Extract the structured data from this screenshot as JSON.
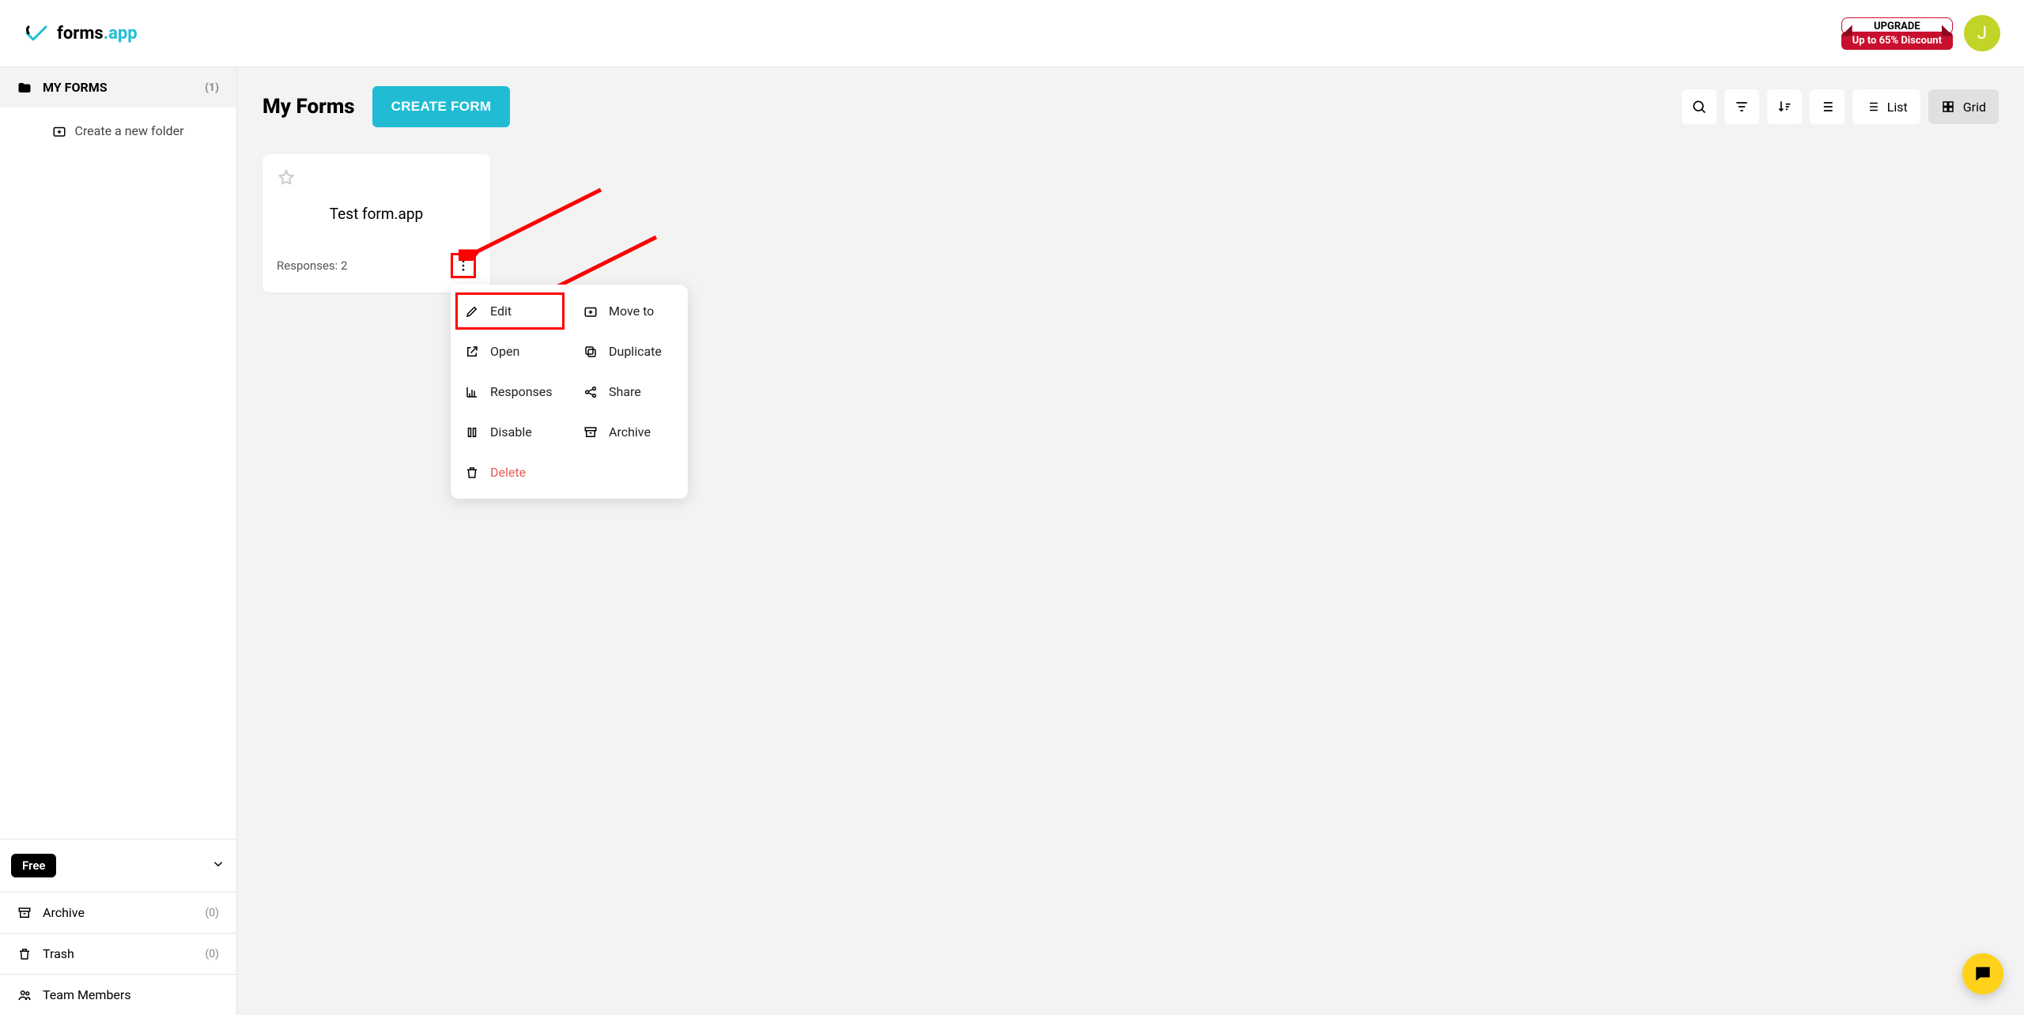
{
  "brand": {
    "name1": "forms",
    "name2": ".app"
  },
  "upgrade": {
    "label": "UPGRADE",
    "banner": "Up to 65% Discount"
  },
  "avatar": {
    "initial": "J"
  },
  "sidebar": {
    "my_forms": {
      "label": "MY FORMS",
      "count": "(1)"
    },
    "new_folder": "Create a new folder",
    "plan_badge": "Free",
    "archive": {
      "label": "Archive",
      "count": "(0)"
    },
    "trash": {
      "label": "Trash",
      "count": "(0)"
    },
    "team": {
      "label": "Team Members"
    }
  },
  "main": {
    "title": "My Forms",
    "create": "CREATE FORM",
    "view": {
      "list": "List",
      "grid": "Grid"
    }
  },
  "card": {
    "title": "Test form.app",
    "responses": "Responses: 2"
  },
  "menu": {
    "edit": "Edit",
    "move": "Move to",
    "open": "Open",
    "duplicate": "Duplicate",
    "responses": "Responses",
    "share": "Share",
    "disable": "Disable",
    "archive": "Archive",
    "delete": "Delete"
  }
}
